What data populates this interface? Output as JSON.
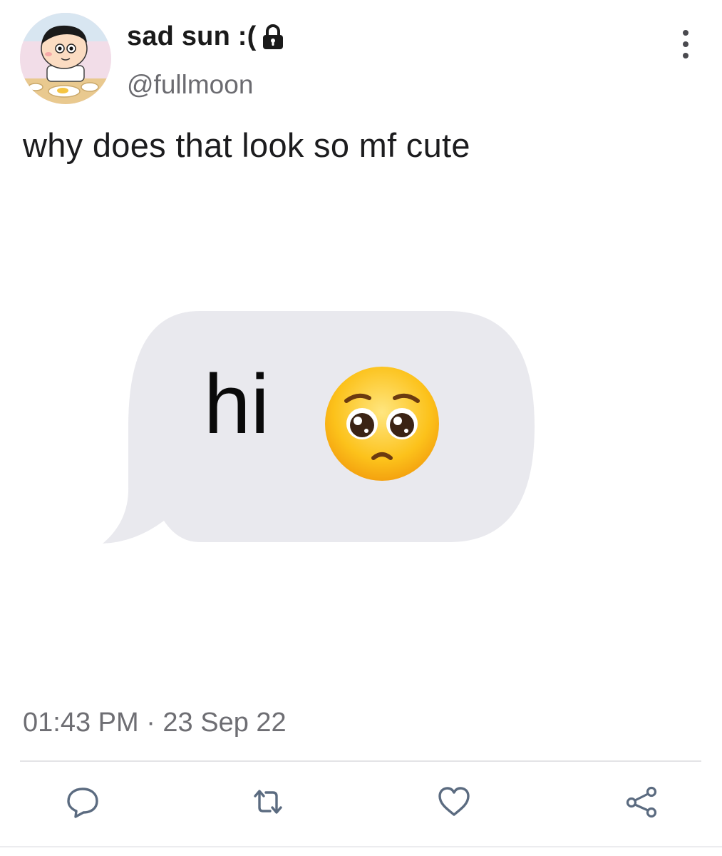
{
  "header": {
    "display_name": "sad sun :(",
    "handle": "@fullmoon",
    "avatar_icon": "cartoon-boy-avatar",
    "lock_icon": "lock-icon",
    "more_icon": "vertical-ellipsis-icon"
  },
  "tweet": {
    "text": "why does that look so mf cute",
    "media": {
      "bubble_text": "hi",
      "emoji": "pleading-face-emoji",
      "bubble_color": "#e9e9ee"
    }
  },
  "meta": {
    "timestamp": "01:43 PM · 23 Sep 22"
  },
  "actions": [
    {
      "name": "reply",
      "icon": "speech-bubble-icon"
    },
    {
      "name": "retweet",
      "icon": "retweet-icon"
    },
    {
      "name": "like",
      "icon": "heart-icon"
    },
    {
      "name": "share",
      "icon": "share-icon"
    }
  ],
  "colors": {
    "text": "#1c1c1e",
    "secondary_text": "#6e6e73",
    "icon": "#5b6b80",
    "divider": "#e3e3e6"
  }
}
